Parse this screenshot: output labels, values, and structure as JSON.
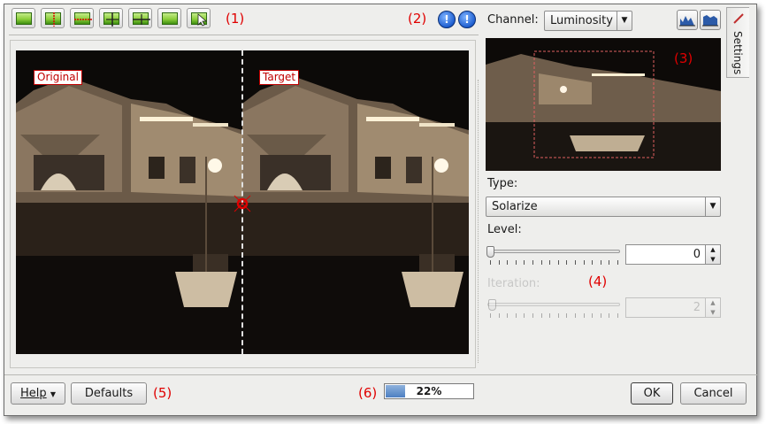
{
  "annotations": {
    "a1": "(1)",
    "a2": "(2)",
    "a3": "(3)",
    "a4": "(4)",
    "a5": "(5)",
    "a6": "(6)"
  },
  "toolbar": {
    "buttons": [
      {
        "name": "original-image-icon"
      },
      {
        "name": "split-vertical-icon"
      },
      {
        "name": "split-horizontal-icon"
      },
      {
        "name": "split-vertical-duplicate-icon"
      },
      {
        "name": "split-horizontal-duplicate-icon"
      },
      {
        "name": "target-image-icon"
      },
      {
        "name": "compare-cursor-icon"
      }
    ],
    "info_buttons": [
      {
        "name": "underexposure-indicator-icon",
        "glyph": "!"
      },
      {
        "name": "overexposure-indicator-icon",
        "glyph": "!"
      }
    ]
  },
  "preview": {
    "original_label": "Original",
    "target_label": "Target"
  },
  "channel": {
    "label": "Channel:",
    "value": "Luminosity"
  },
  "settings_tab": {
    "label": "Settings"
  },
  "type": {
    "label": "Type:",
    "value": "Solarize"
  },
  "level": {
    "label": "Level:",
    "value": "0"
  },
  "iteration": {
    "label": "Iteration:",
    "value": "2"
  },
  "buttons": {
    "help": "Help",
    "defaults": "Defaults",
    "ok": "OK",
    "cancel": "Cancel"
  },
  "progress": {
    "value_percent": 22,
    "text": "22%"
  },
  "colors": {
    "annotation": "#e00000",
    "progress_fill": "#4d7fc2"
  }
}
